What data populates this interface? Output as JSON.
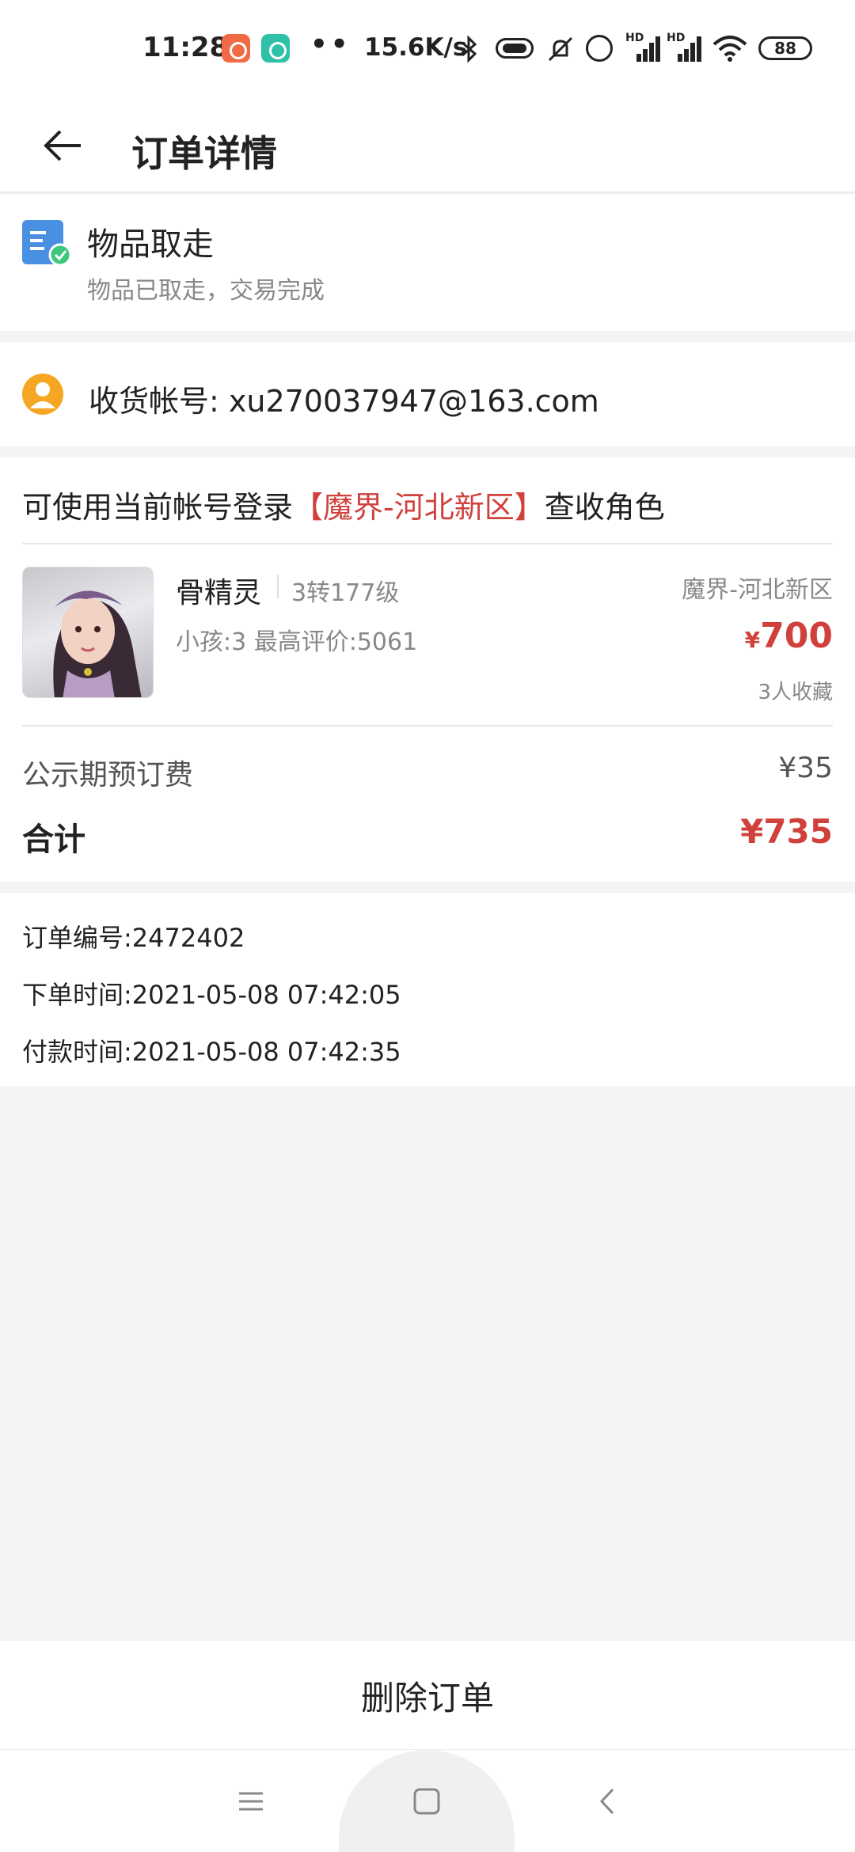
{
  "status_bar": {
    "time": "11:28",
    "dots": "••",
    "speed": "15.6K/s",
    "hd1": "HD",
    "hd2": "HD",
    "battery": "88"
  },
  "header": {
    "title": "订单详情"
  },
  "order_status": {
    "title": "物品取走",
    "subtitle": "物品已取走，交易完成"
  },
  "account": {
    "label": "收货帐号: xu270037947@163.com"
  },
  "product": {
    "login_tip_prefix": "可使用当前帐号登录",
    "login_tip_server": "【魔界-河北新区】",
    "login_tip_suffix": "查收角色",
    "name": "骨精灵",
    "level": "3转177级",
    "meta": "小孩:3 最高评价:5061",
    "server": "魔界-河北新区",
    "price_symbol": "¥",
    "price": "700",
    "favorites": "3人收藏"
  },
  "fees": {
    "fee_label": "公示期预订费",
    "fee_value": "¥35",
    "total_label": "合计",
    "total_value": "¥735"
  },
  "order_info": {
    "order_no": "订单编号:2472402",
    "order_time": "下单时间:2021-05-08 07:42:05",
    "pay_time": "付款时间:2021-05-08 07:42:35"
  },
  "actions": {
    "delete_label": "删除订单"
  },
  "colors": {
    "accent": "#d0413c",
    "status_blue": "#4a90e2",
    "status_green": "#3cc77d",
    "avatar_orange": "#f5a623"
  }
}
